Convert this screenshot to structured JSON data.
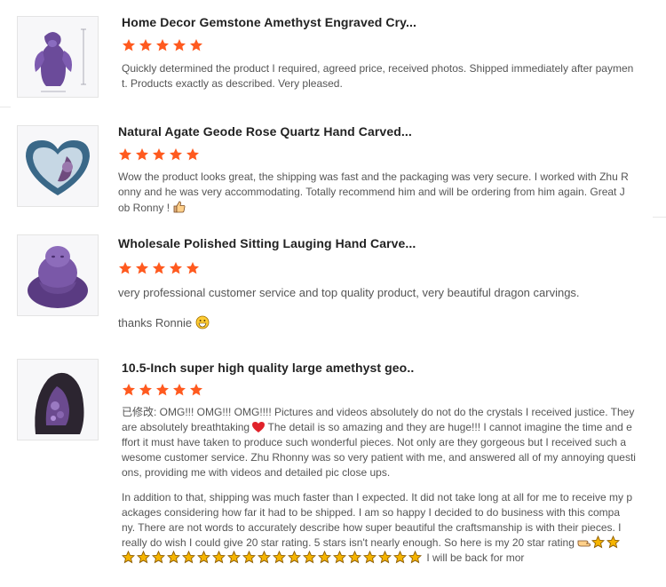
{
  "colors": {
    "star": "#ff5a1f",
    "title": "#222222",
    "text": "#555555",
    "gold_star": "#f5b400"
  },
  "reviews": [
    {
      "title": "Home Decor Gemstone Amethyst Engraved Cry...",
      "rating": 5,
      "lines": [
        "Quickly determined the product I required, agreed price, received photos. Shipped immediately after paymen",
        "t. Products exactly as described. Very pleased."
      ]
    },
    {
      "title": "Natural Agate Geode Rose Quartz Hand Carved...",
      "rating": 5,
      "lines": [
        "Wow the product looks great, the shipping was fast and the packaging was very secure. I worked with Zhu R",
        "onny and he was very accommodating. Totally recommend him and will be ordering from him again. Great J",
        "ob Ronny !"
      ]
    },
    {
      "title": "Wholesale Polished Sitting Lauging Hand Carve...",
      "rating": 5,
      "line1": "very professional customer service and top quality product, very beautiful dragon carvings.",
      "line2": "thanks Ronnie"
    },
    {
      "title": "10.5-Inch super high quality large amethyst geo..",
      "rating": 5,
      "p1_lines": [
        "已修改: OMG!!! OMG!!! OMG!!!! Pictures and videos absolutely do not do the crystals I received justice. They",
        " are absolutely breathtaking",
        " The detail is so amazing and they are huge!!! I cannot imagine the time and e",
        "ffort it must have taken to produce such wonderful pieces. Not only are they gorgeous but I received such a",
        "wesome customer service. Zhu Rhonny was so very patient with me, and answered all of my annoying questi",
        "ons, providing me with videos and detailed pic close ups."
      ],
      "p2_lines": [
        "In addition to that, shipping was much faster than I expected. It did not take long at all for me to receive my p",
        "ackages considering how far it had to be shipped.  I am so happy   I decided to do business with this compa",
        "ny.  There are not words to accurately describe how  super beautiful the craftsmanship is with their pieces. I",
        " really do wish I could give 20 star rating.  5   stars isn't nearly enough. So here is my 20 star rating"
      ],
      "gold_star_count": 20,
      "tail": " I will be back for mor"
    }
  ]
}
